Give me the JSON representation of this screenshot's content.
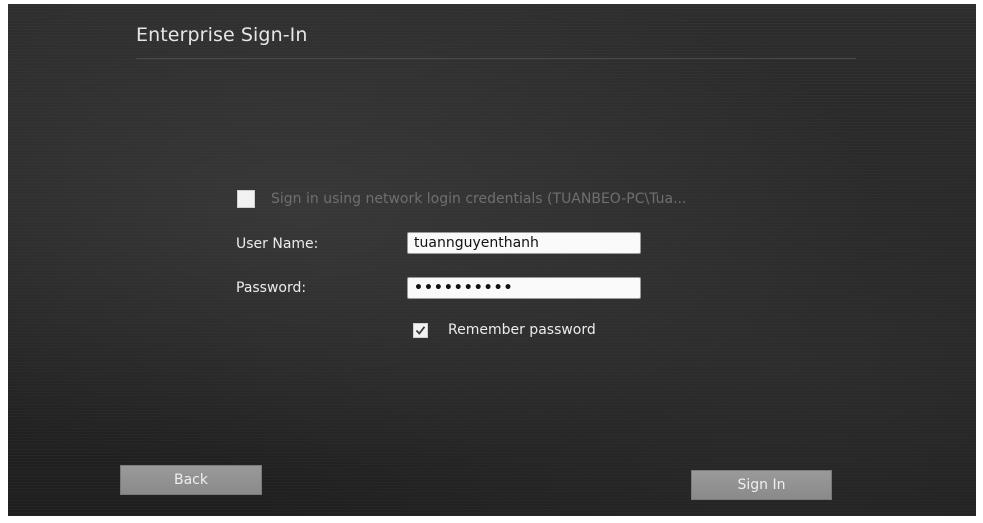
{
  "window": {
    "title": "Enterprise Sign-In"
  },
  "network_login": {
    "checked": false,
    "label": "Sign in using network login credentials (TUANBEO-PC\\Tua..."
  },
  "form": {
    "username_label": "User Name:",
    "username_value": "tuannguyenthanh",
    "password_label": "Password:",
    "password_value": "••••••••••"
  },
  "remember": {
    "checked": true,
    "label": "Remember password"
  },
  "buttons": {
    "back_label": "Back",
    "signin_label": "Sign In"
  },
  "colors": {
    "background": "#262626",
    "text": "#ececec",
    "muted_text": "#6f6f6f",
    "button": "#909090"
  }
}
